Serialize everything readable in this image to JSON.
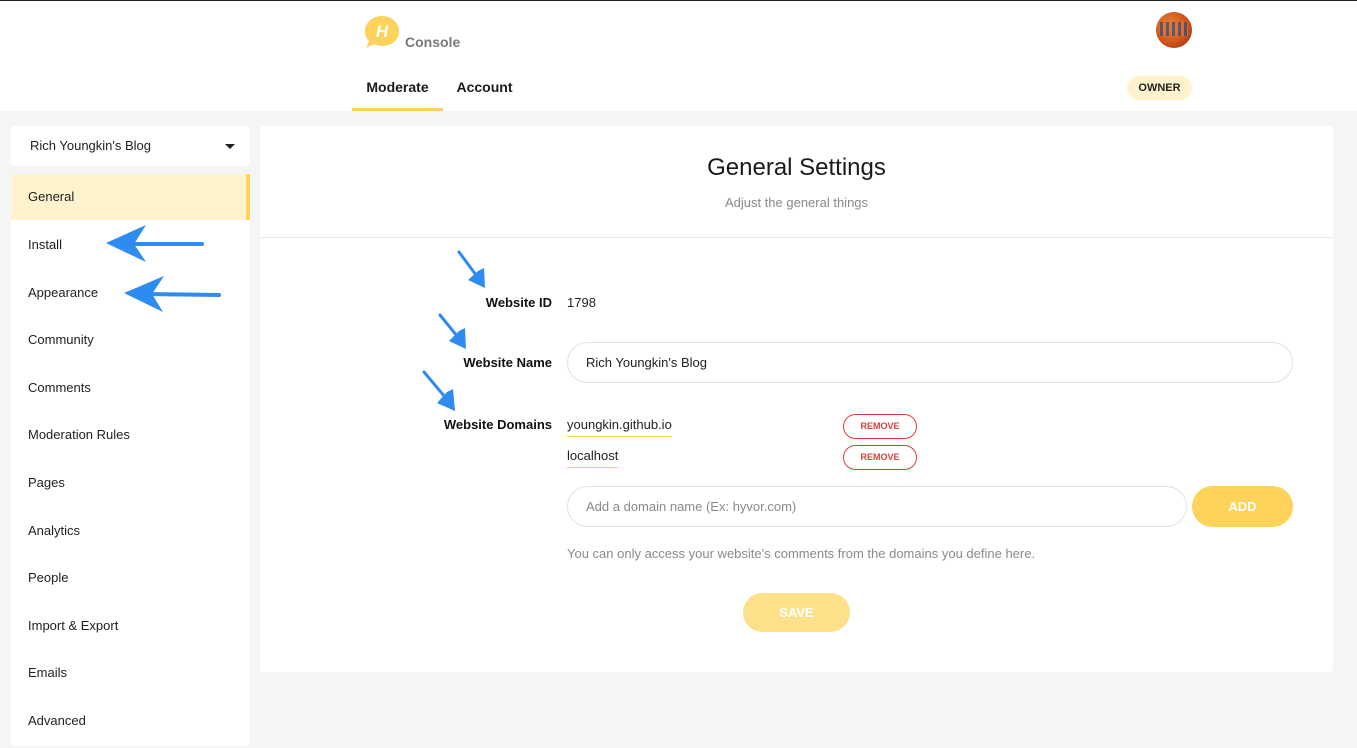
{
  "header": {
    "logo_letter": "H",
    "app_title": "Console",
    "tabs": [
      {
        "label": "Moderate",
        "active": true
      },
      {
        "label": "Account",
        "active": false
      }
    ],
    "role_badge": "OWNER"
  },
  "sidebar": {
    "site_selector": "Rich Youngkin's Blog",
    "items": [
      {
        "label": "General",
        "active": true
      },
      {
        "label": "Install"
      },
      {
        "label": "Appearance"
      },
      {
        "label": "Community"
      },
      {
        "label": "Comments"
      },
      {
        "label": "Moderation Rules"
      },
      {
        "label": "Pages"
      },
      {
        "label": "Analytics"
      },
      {
        "label": "People"
      },
      {
        "label": "Import & Export"
      },
      {
        "label": "Emails"
      },
      {
        "label": "Advanced"
      }
    ]
  },
  "main": {
    "title": "General Settings",
    "subtitle": "Adjust the general things",
    "website_id_label": "Website ID",
    "website_id": "1798",
    "website_name_label": "Website Name",
    "website_name": "Rich Youngkin's Blog",
    "website_domains_label": "Website Domains",
    "domains": [
      {
        "name": "youngkin.github.io",
        "remove_label": "REMOVE"
      },
      {
        "name": "localhost",
        "remove_label": "REMOVE"
      }
    ],
    "domain_placeholder": "Add a domain name (Ex: hyvor.com)",
    "add_label": "ADD",
    "hint": "You can only access your website's comments from the domains you define here.",
    "save_label": "SAVE"
  },
  "colors": {
    "accent": "#fdd35b",
    "accent_light": "#fff3cd",
    "danger": "#e03b3b",
    "annotation_arrow": "#2e8bf0"
  }
}
